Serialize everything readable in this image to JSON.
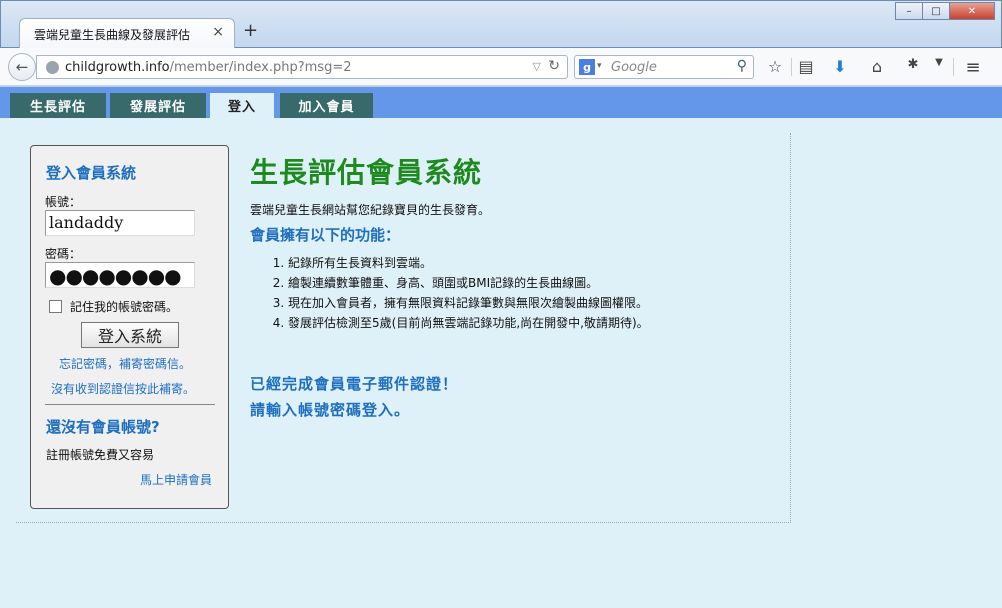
{
  "browser": {
    "tab_title": "雲端兒童生長曲線及發展評估",
    "tab_close": "×",
    "new_tab": "+",
    "url_host": "childgrowth.info",
    "url_path": "/member/index.php?msg=2",
    "search_engine": "g",
    "search_placeholder": "Google",
    "window_buttons": {
      "minimize": "–",
      "maximize": "□",
      "close": "✕"
    }
  },
  "site_nav": {
    "tabs": [
      {
        "label": "生長評估",
        "active": false
      },
      {
        "label": "發展評估",
        "active": false
      },
      {
        "label": "登入",
        "active": true
      },
      {
        "label": "加入會員",
        "active": false
      }
    ]
  },
  "login": {
    "title": "登入會員系統",
    "account_label": "帳號：",
    "account_value": "landaddy",
    "password_label": "密碼：",
    "password_value": "●●●●●●●●",
    "remember_label": "記住我的帳號密碼。",
    "submit_label": "登入系統",
    "forgot_link": "忘記密碼，補寄密碼信。",
    "resend_link": "沒有收到認證信按此補寄。",
    "no_account_title": "還沒有會員帳號?",
    "no_account_text": "註冊帳號免費又容易",
    "signup_link": "馬上申請會員"
  },
  "main": {
    "title": "生長評估會員系統",
    "intro": "雲端兒童生長網站幫您紀錄寶貝的生長發育。",
    "features_title": "會員擁有以下的功能：",
    "features": [
      "紀錄所有生長資料到雲端。",
      "繪製連續數筆體重、身高、頭圍或BMI記錄的生長曲線圖。",
      "現在加入會員者，擁有無限資料記錄筆數與無限次繪製曲線圖權限。",
      "發展評估檢測至5歲(目前尚無雲端記錄功能,尚在開發中,敬請期待)。"
    ],
    "message_line1": "已經完成會員電子郵件認證！",
    "message_line2": "請輸入帳號密碼登入。"
  }
}
